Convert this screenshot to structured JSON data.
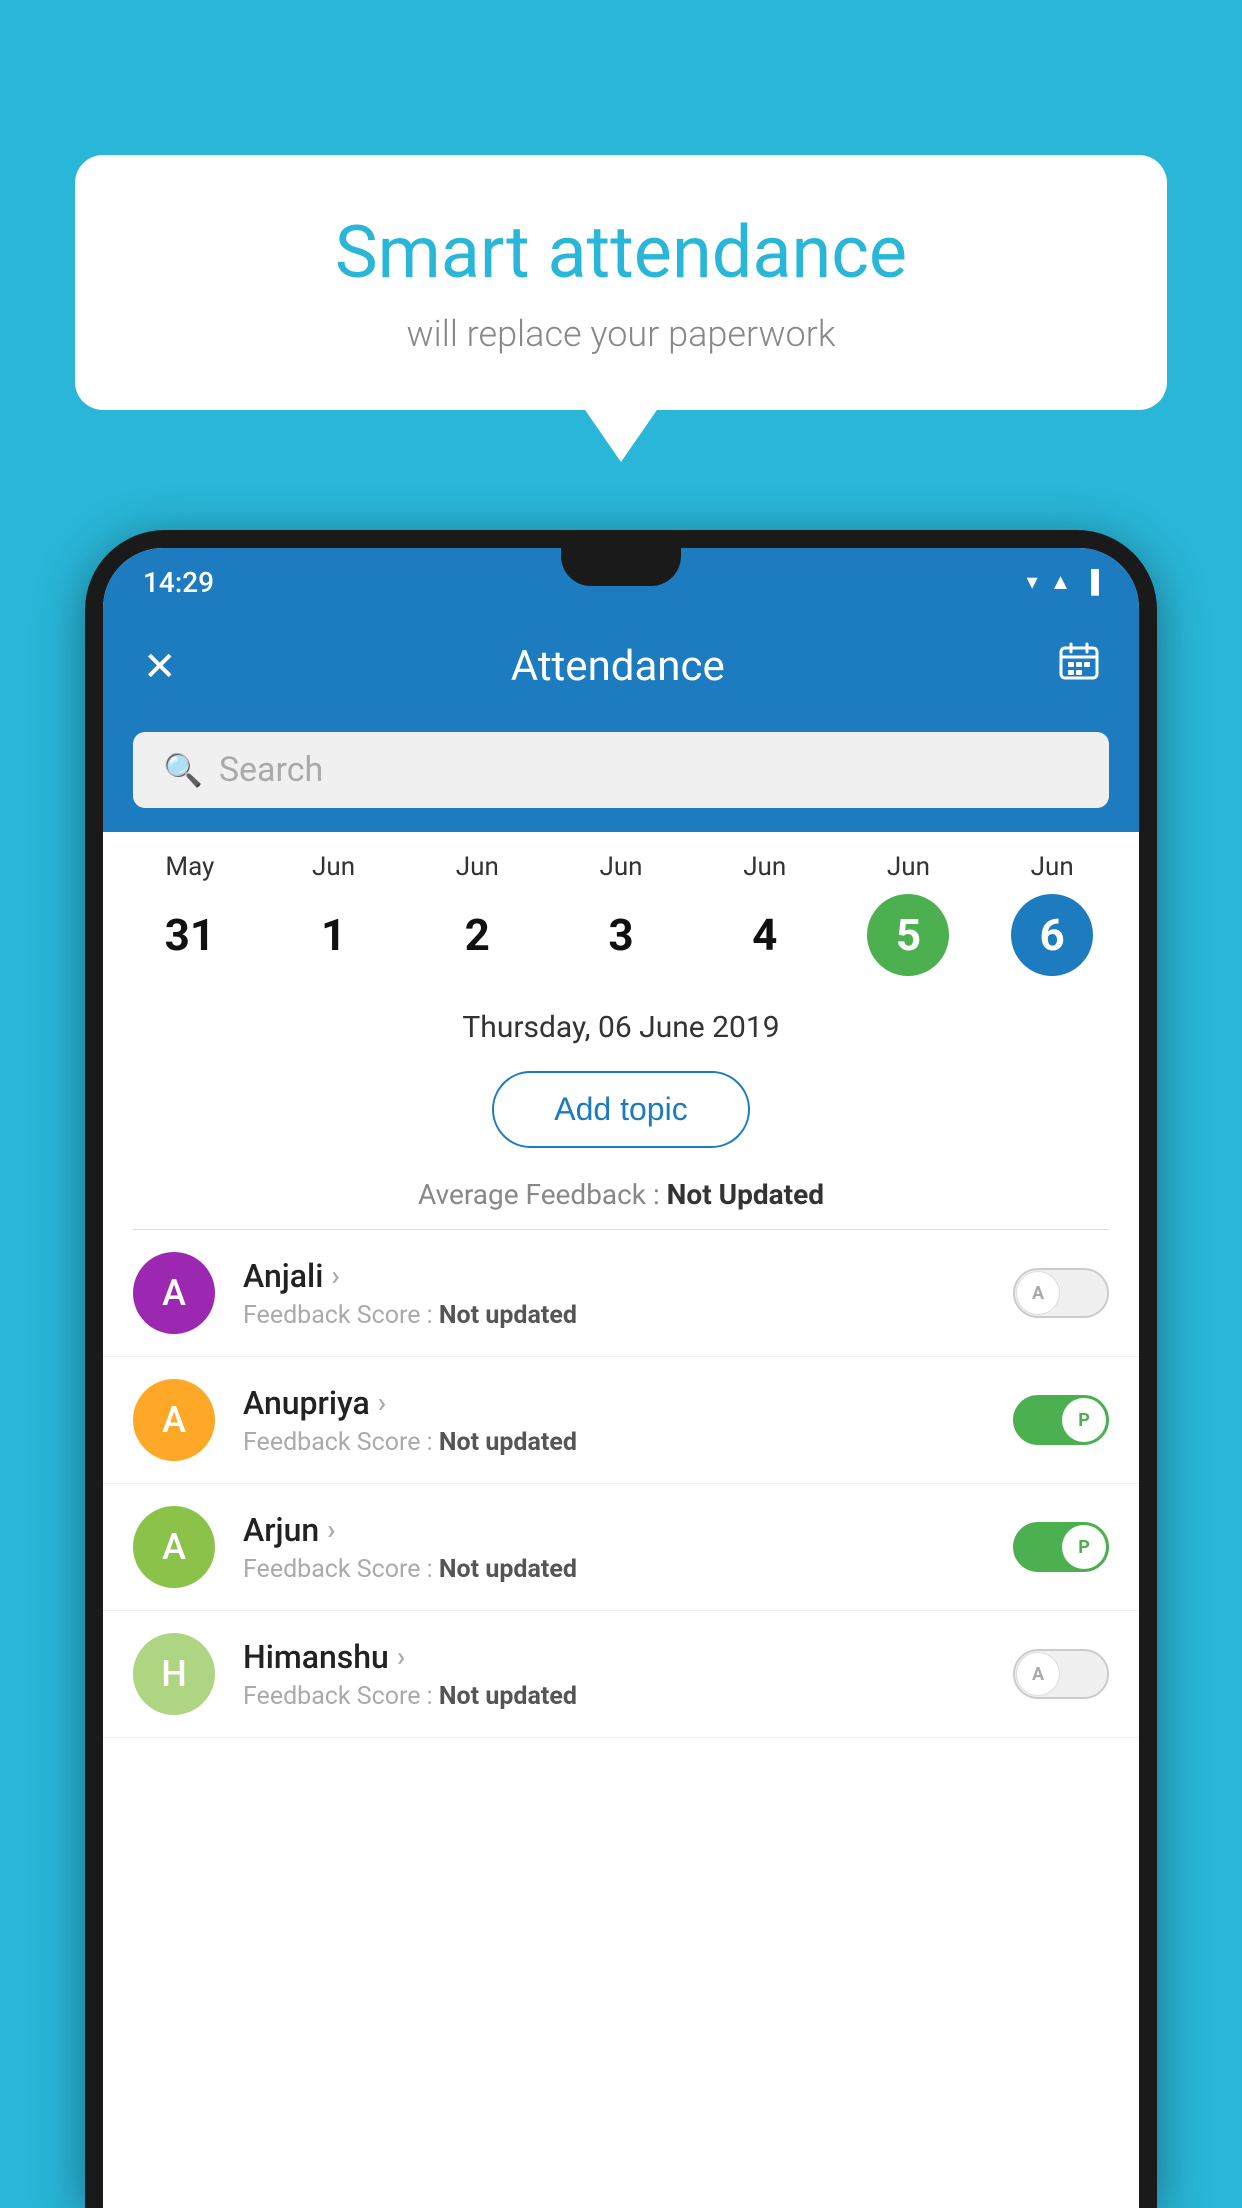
{
  "background_color": "#29b6d8",
  "bubble": {
    "title": "Smart attendance",
    "subtitle": "will replace your paperwork"
  },
  "status_bar": {
    "time": "14:29",
    "icons": [
      "wifi",
      "signal",
      "battery"
    ]
  },
  "app_bar": {
    "title": "Attendance",
    "close_label": "✕",
    "calendar_label": "📅"
  },
  "search": {
    "placeholder": "Search"
  },
  "calendar": {
    "days": [
      {
        "month": "May",
        "date": "31",
        "state": "normal"
      },
      {
        "month": "Jun",
        "date": "1",
        "state": "normal"
      },
      {
        "month": "Jun",
        "date": "2",
        "state": "normal"
      },
      {
        "month": "Jun",
        "date": "3",
        "state": "normal"
      },
      {
        "month": "Jun",
        "date": "4",
        "state": "normal"
      },
      {
        "month": "Jun",
        "date": "5",
        "state": "today"
      },
      {
        "month": "Jun",
        "date": "6",
        "state": "selected"
      }
    ],
    "selected_date_label": "Thursday, 06 June 2019"
  },
  "add_topic": {
    "label": "Add topic"
  },
  "avg_feedback": {
    "label": "Average Feedback : ",
    "value": "Not Updated"
  },
  "students": [
    {
      "name": "Anjali",
      "avatar_letter": "A",
      "avatar_color": "#9c27b0",
      "score_label": "Feedback Score : ",
      "score_value": "Not updated",
      "attendance": "off",
      "toggle_letter": "A"
    },
    {
      "name": "Anupriya",
      "avatar_letter": "A",
      "avatar_color": "#ffa726",
      "score_label": "Feedback Score : ",
      "score_value": "Not updated",
      "attendance": "on",
      "toggle_letter": "P"
    },
    {
      "name": "Arjun",
      "avatar_letter": "A",
      "avatar_color": "#8bc34a",
      "score_label": "Feedback Score : ",
      "score_value": "Not updated",
      "attendance": "on",
      "toggle_letter": "P"
    },
    {
      "name": "Himanshu",
      "avatar_letter": "H",
      "avatar_color": "#aed581",
      "score_label": "Feedback Score : ",
      "score_value": "Not updated",
      "attendance": "off",
      "toggle_letter": "A"
    }
  ]
}
